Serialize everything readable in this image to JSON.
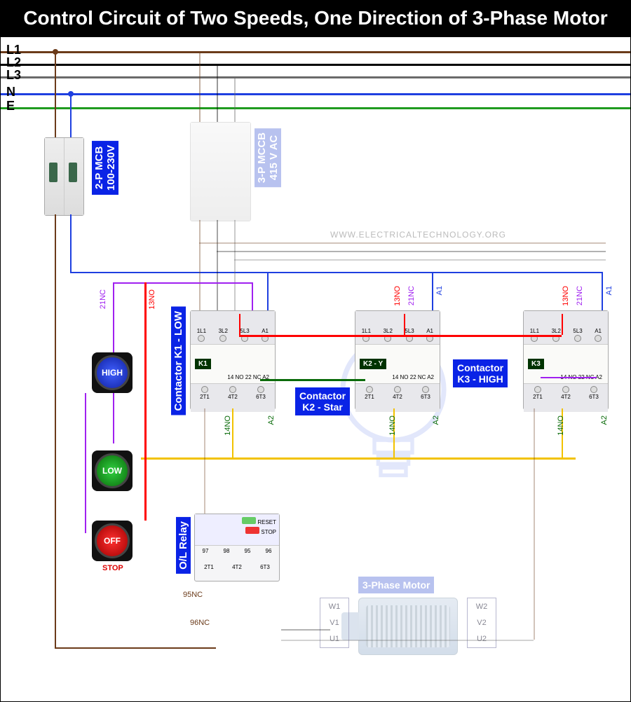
{
  "title": "Control Circuit of Two Speeds, One Direction of 3-Phase Motor",
  "supply": {
    "L1": "L1",
    "L2": "L2",
    "L3": "L3",
    "N": "N",
    "E": "E"
  },
  "colors": {
    "L1": "#6b3b1a",
    "L2": "#000000",
    "L3": "#6a6a6a",
    "N": "#1e3fe0",
    "E": "#1f9b1f",
    "red": "#ff0000",
    "purple": "#a020f0",
    "yellow": "#f2c200",
    "darkgreen": "#0a6b0a"
  },
  "mcb": {
    "label": "2-P MCB\n100-230V"
  },
  "mccb": {
    "label": "3-P MCCB\n415 V AC"
  },
  "watermark": "WWW.ELECTRICALTECHNOLOGY.ORG",
  "contactors": {
    "k1": {
      "label": "Contactor K1 - LOW",
      "mod": "K1",
      "top": [
        "1L1",
        "3L2",
        "5L3",
        "A1",
        "13 NO",
        "21"
      ],
      "bot": [
        "2T1",
        "4T2",
        "6T3",
        "14",
        "NO 22",
        "NC",
        "A2"
      ]
    },
    "k2": {
      "label": "Contactor\nK2 - Star",
      "mod": "K2 - Y",
      "top": [
        "1L1",
        "3L2",
        "5L3",
        "A1",
        "13 NO",
        "21"
      ],
      "bot": [
        "2T1",
        "4T2",
        "6T3",
        "14",
        "NO 22",
        "NC",
        "A2"
      ]
    },
    "k3": {
      "label": "Contactor\nK3 - HIGH",
      "mod": "K3",
      "top": [
        "1L1",
        "3L2",
        "5L3",
        "A1",
        "13 NO",
        "21"
      ],
      "bot": [
        "2T1",
        "4T2",
        "6T3",
        "14",
        "NO 22",
        "NC",
        "A2"
      ]
    }
  },
  "buttons": {
    "high": "HIGH",
    "low": "LOW",
    "off": "OFF",
    "stop": "STOP"
  },
  "aux": {
    "nc21": "21NC",
    "no13": "13NO",
    "no14": "14NO",
    "a2": "A2",
    "a1": "A1",
    "nc95": "95NC",
    "nc96": "96NC"
  },
  "olr": {
    "label": "O/L Relay",
    "top": [
      "97",
      "98",
      "95",
      "96"
    ],
    "bot": [
      "2T1",
      "4T2",
      "6T3"
    ],
    "reset": "RESET",
    "stop": "STOP"
  },
  "motor": {
    "label": "3-Phase Motor",
    "t1": [
      "W1",
      "V1",
      "U1"
    ],
    "t2": [
      "W2",
      "V2",
      "U2"
    ]
  }
}
